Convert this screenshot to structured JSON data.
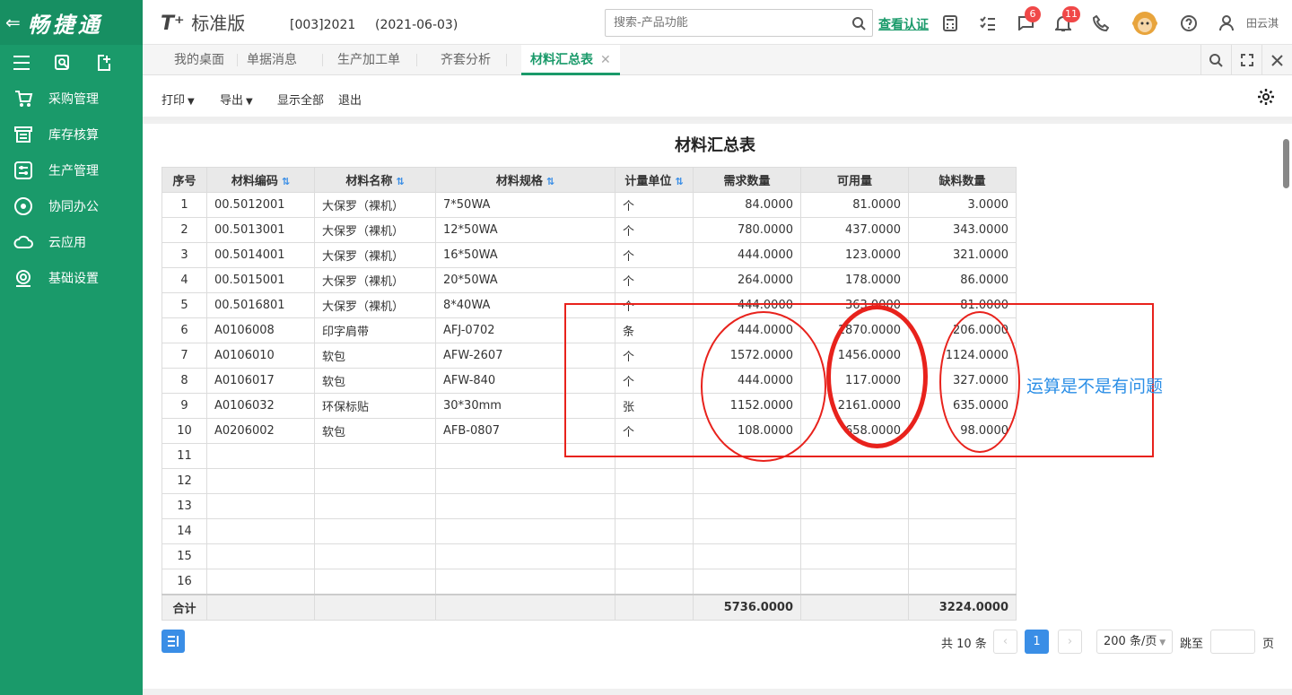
{
  "sidebar": {
    "logo": "畅捷通",
    "items": [
      {
        "label": "采购管理",
        "icon": "cart-icon"
      },
      {
        "label": "库存核算",
        "icon": "warehouse-icon"
      },
      {
        "label": "生产管理",
        "icon": "sliders-icon"
      },
      {
        "label": "协同办公",
        "icon": "signal-icon"
      },
      {
        "label": "云应用",
        "icon": "cloud-icon"
      },
      {
        "label": "基础设置",
        "icon": "settings-icon"
      }
    ]
  },
  "header": {
    "brand": "T⁺",
    "brand_sub": "标准版",
    "account": "[003]2021",
    "date": "(2021-06-03)",
    "search_placeholder": "搜索-产品功能",
    "verify": "查看认证",
    "messages_badge": "6",
    "notify_badge": "11",
    "user": "田云淇"
  },
  "tabs": [
    {
      "label": "我的桌面"
    },
    {
      "label": "单据消息"
    },
    {
      "label": "生产加工单"
    },
    {
      "label": "齐套分析"
    },
    {
      "label": "材料汇总表"
    }
  ],
  "toolbar": {
    "print": "打印",
    "export": "导出",
    "show_all": "显示全部",
    "exit": "退出"
  },
  "report": {
    "title": "材料汇总表",
    "columns": [
      "序号",
      "材料编码",
      "材料名称",
      "材料规格",
      "计量单位",
      "需求数量",
      "可用量",
      "缺料数量"
    ],
    "rows": [
      [
        "1",
        "00.5012001",
        "大保罗（裸机）",
        "7*50WA",
        "个",
        "84.0000",
        "81.0000",
        "3.0000"
      ],
      [
        "2",
        "00.5013001",
        "大保罗（裸机）",
        "12*50WA",
        "个",
        "780.0000",
        "437.0000",
        "343.0000"
      ],
      [
        "3",
        "00.5014001",
        "大保罗（裸机）",
        "16*50WA",
        "个",
        "444.0000",
        "123.0000",
        "321.0000"
      ],
      [
        "4",
        "00.5015001",
        "大保罗（裸机）",
        "20*50WA",
        "个",
        "264.0000",
        "178.0000",
        "86.0000"
      ],
      [
        "5",
        "00.5016801",
        "大保罗（裸机）",
        "8*40WA",
        "个",
        "444.0000",
        "363.0000",
        "81.0000"
      ],
      [
        "6",
        "A0106008",
        "印字肩带",
        "AFJ-0702",
        "条",
        "444.0000",
        "1870.0000",
        "206.0000"
      ],
      [
        "7",
        "A0106010",
        "软包",
        "AFW-2607",
        "个",
        "1572.0000",
        "1456.0000",
        "1124.0000"
      ],
      [
        "8",
        "A0106017",
        "软包",
        "AFW-840",
        "个",
        "444.0000",
        "117.0000",
        "327.0000"
      ],
      [
        "9",
        "A0106032",
        "环保标贴",
        "30*30mm",
        "张",
        "1152.0000",
        "2161.0000",
        "635.0000"
      ],
      [
        "10",
        "A0206002",
        "软包",
        "AFB-0807",
        "个",
        "108.0000",
        "658.0000",
        "98.0000"
      ],
      [
        "11",
        "",
        "",
        "",
        "",
        "",
        "",
        ""
      ],
      [
        "12",
        "",
        "",
        "",
        "",
        "",
        "",
        ""
      ],
      [
        "13",
        "",
        "",
        "",
        "",
        "",
        "",
        ""
      ],
      [
        "14",
        "",
        "",
        "",
        "",
        "",
        "",
        ""
      ],
      [
        "15",
        "",
        "",
        "",
        "",
        "",
        "",
        ""
      ],
      [
        "16",
        "",
        "",
        "",
        "",
        "",
        "",
        ""
      ]
    ],
    "total": {
      "label": "合计",
      "demand": "5736.0000",
      "shortage": "3224.0000"
    }
  },
  "annotation": "运算是不是有问题",
  "pagination": {
    "total": "共 10 条",
    "page": "1",
    "page_size": "200 条/页",
    "jump_label": "跳至",
    "page_suffix": "页"
  },
  "colors": {
    "brand": "#1a9a6a",
    "primary": "#3a8ee6",
    "annotation": "#e8221c"
  }
}
